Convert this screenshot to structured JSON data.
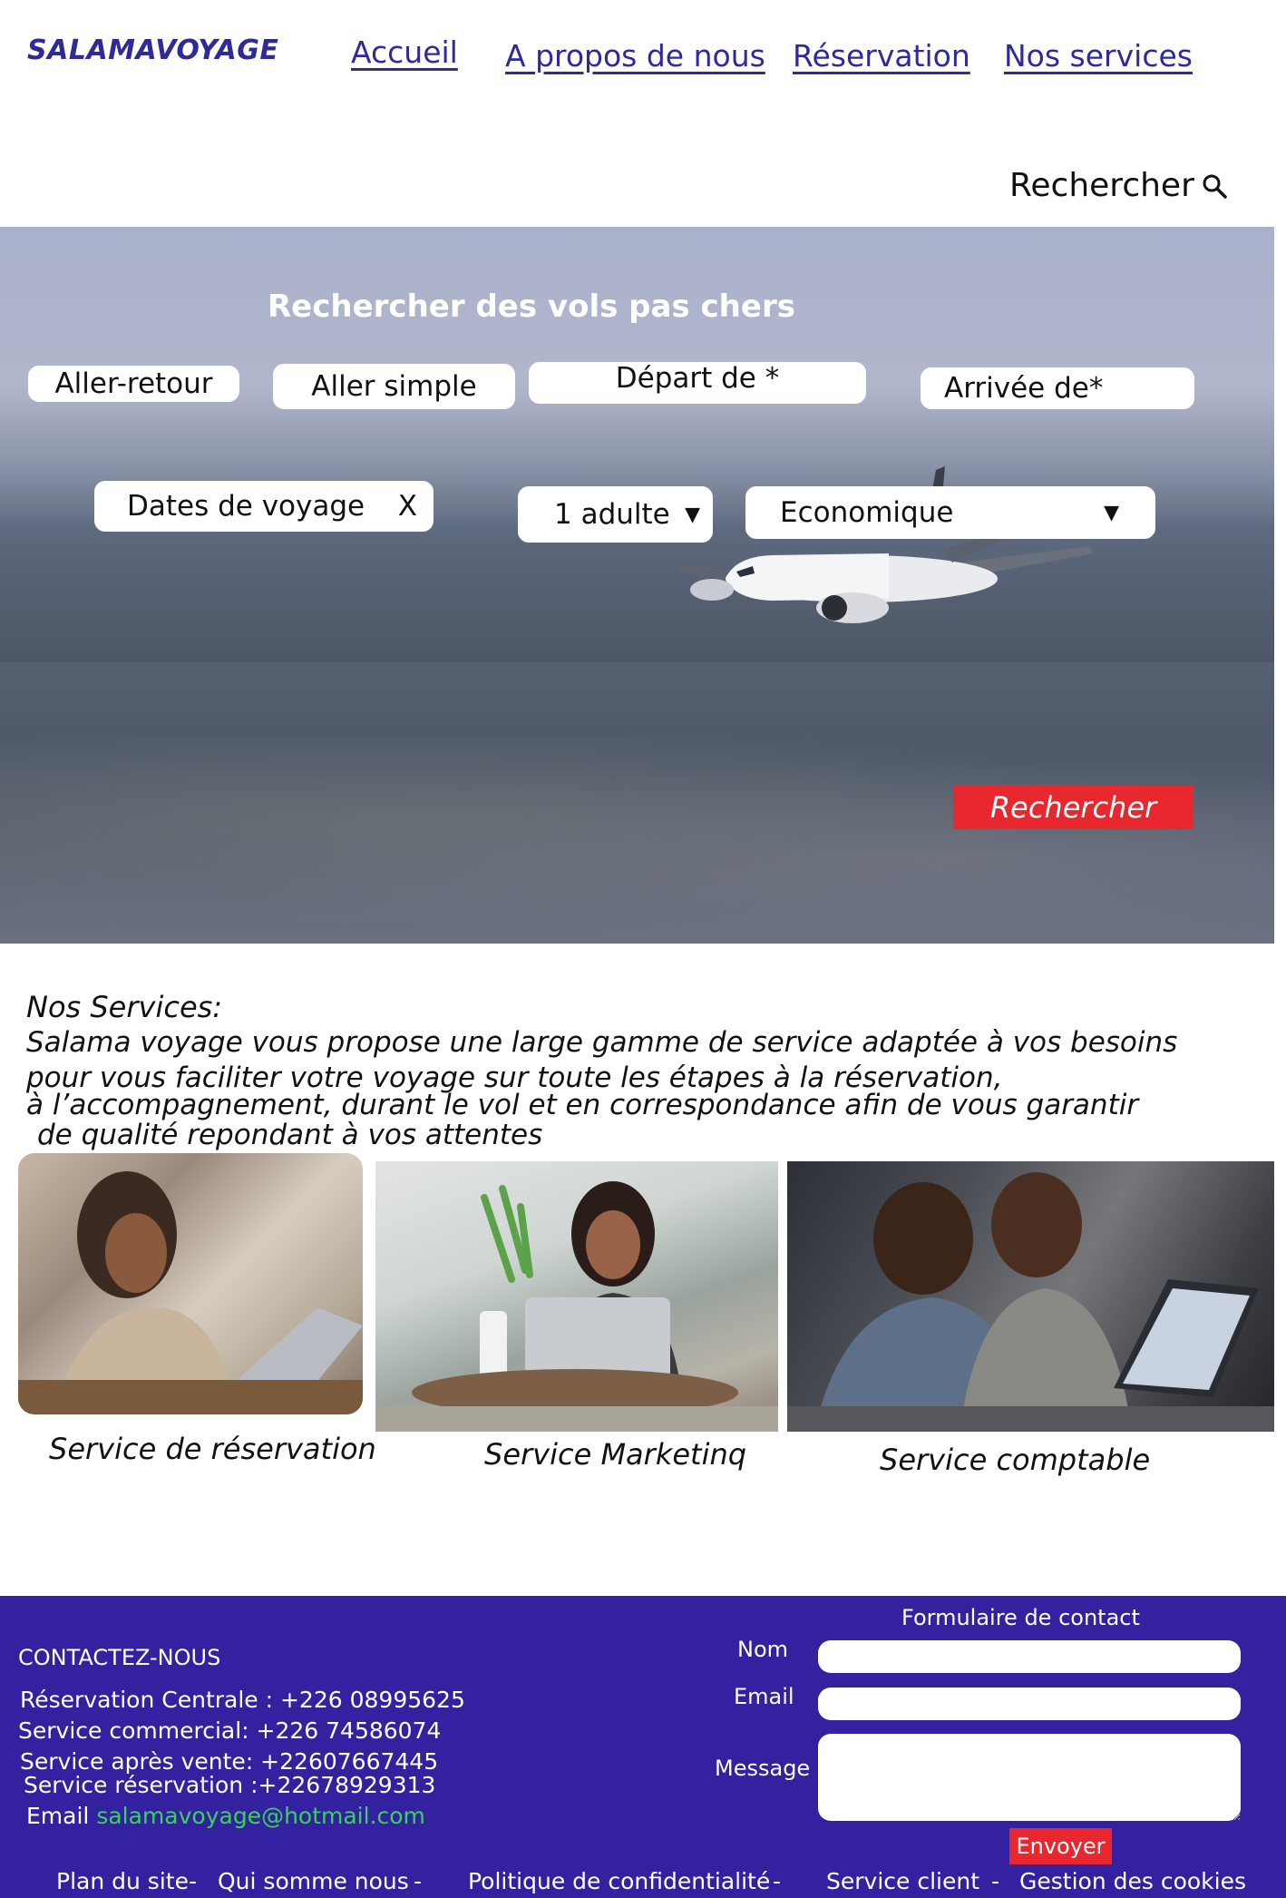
{
  "header": {
    "logo": "SALAMAVOYAGE",
    "nav": [
      "Accueil",
      "A propos de nous",
      "Réservation",
      "Nos services"
    ],
    "search_label": "Rechercher"
  },
  "hero": {
    "title": "Rechercher des vols pas chers",
    "trip_types": [
      "Aller-retour",
      "Aller simple"
    ],
    "departure_placeholder": "Départ de *",
    "arrival_placeholder": "Arrivée de*",
    "dates_label": "Dates de voyage",
    "dates_clear": "X",
    "passengers": "1 adulte",
    "cabin_class": "Economique",
    "search_button": "Rechercher"
  },
  "services": {
    "heading": "Nos Services:",
    "description_lines": [
      "Salama voyage vous propose une large gamme de service adaptée à vos besoins",
      "pour vous faciliter votre voyage sur toute les étapes à la réservation,",
      "à l’accompagnement, durant le vol et en correspondance afin de vous garantir",
      "de qualité repondant à vos attentes"
    ],
    "cards": [
      {
        "caption": "Service de réservation"
      },
      {
        "caption": "Service Marketinq"
      },
      {
        "caption": "Service  comptable"
      }
    ]
  },
  "footer": {
    "contact_title": "CONTACTEZ-NOUS",
    "contact_lines": [
      "Réservation Centrale : +226 08995625",
      "Service commercial: +226 74586074",
      "Service après vente: +22607667445",
      "Service réservation :+22678929313"
    ],
    "email_label": "Email",
    "email_value": "salamavoyage@hotmail.com",
    "form": {
      "title": "Formulaire de contact",
      "name_label": "Nom",
      "email_label": "Email",
      "message_label": "Message",
      "submit": "Envoyer"
    },
    "links": [
      "Plan du site",
      "Qui somme nous",
      "Politique de confidentialité",
      "Service client",
      "Gestion des cookies"
    ],
    "separator": "-"
  },
  "colors": {
    "brand": "#2e2a9c",
    "footer_bg": "#3421a0",
    "accent_red": "#e8282e",
    "email_green": "#37d35a"
  },
  "icons": {
    "search": "magnifier-icon",
    "dropdown": "caret-down-icon"
  }
}
